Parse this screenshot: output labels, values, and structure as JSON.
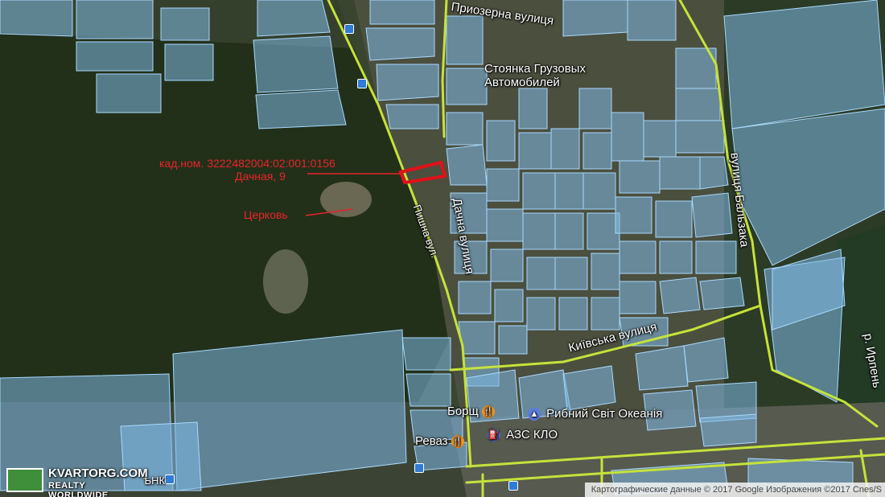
{
  "map": {
    "annotations": {
      "cadastral_number": "кад.ном. 3222482004:02:001:0156",
      "address": "Дачная, 9",
      "church": "Церковь"
    },
    "streets": {
      "pryozerna": "Приозерна вулиця",
      "dachna": "Дачна вулиця",
      "kyivska": "Київська вулиця",
      "balzaka": "вулиця Бальзака",
      "pyshna": "Пишна вул.",
      "irpin": "р. Ирпень"
    },
    "pois": {
      "truck_parking": "Стоянка Грузовых Автомобилей",
      "borshch": "Борщ",
      "fish_world": "Рибний Світ Океанія",
      "revaz": "Реваз",
      "gas_station": "АЗС КЛО",
      "wnk": "ѢНК"
    },
    "icons": {
      "food": "fork-knife-icon",
      "shop": "shopping-bag-icon",
      "fuel": "fuel-pump-icon",
      "bus": "bus-stop-icon"
    },
    "colors": {
      "parcel_fill": "#7fb9e6",
      "parcel_stroke": "#a9d8ff",
      "road": "#c6e23a",
      "target": "#e3101a",
      "annotation": "#e8232a",
      "forest": "#243119"
    },
    "attribution": "Картографические данные © 2017 Google Изображения ©2017 Cnes/S",
    "logo": {
      "brand": "KVARTORG.COM",
      "tagline": "REALTY WORLDWIDE"
    }
  }
}
